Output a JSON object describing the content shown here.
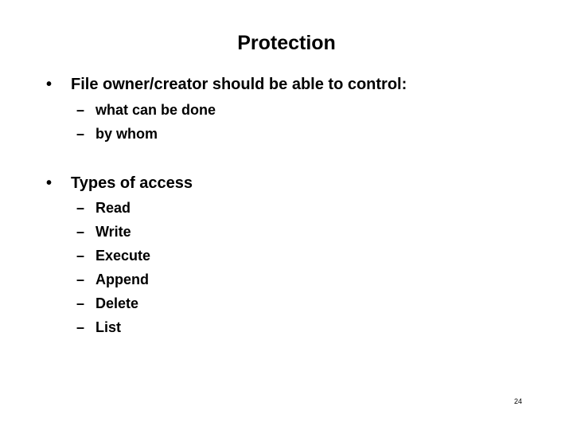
{
  "slide": {
    "title": "Protection",
    "bullet_glyph": "•",
    "dash_glyph": "–",
    "sections": [
      {
        "text": "File owner/creator should be able to control:",
        "items": [
          "what can be done",
          "by whom"
        ]
      },
      {
        "text": "Types of access",
        "items": [
          "Read",
          "Write",
          "Execute",
          "Append",
          "Delete",
          "List"
        ]
      }
    ],
    "page_number": "24"
  }
}
